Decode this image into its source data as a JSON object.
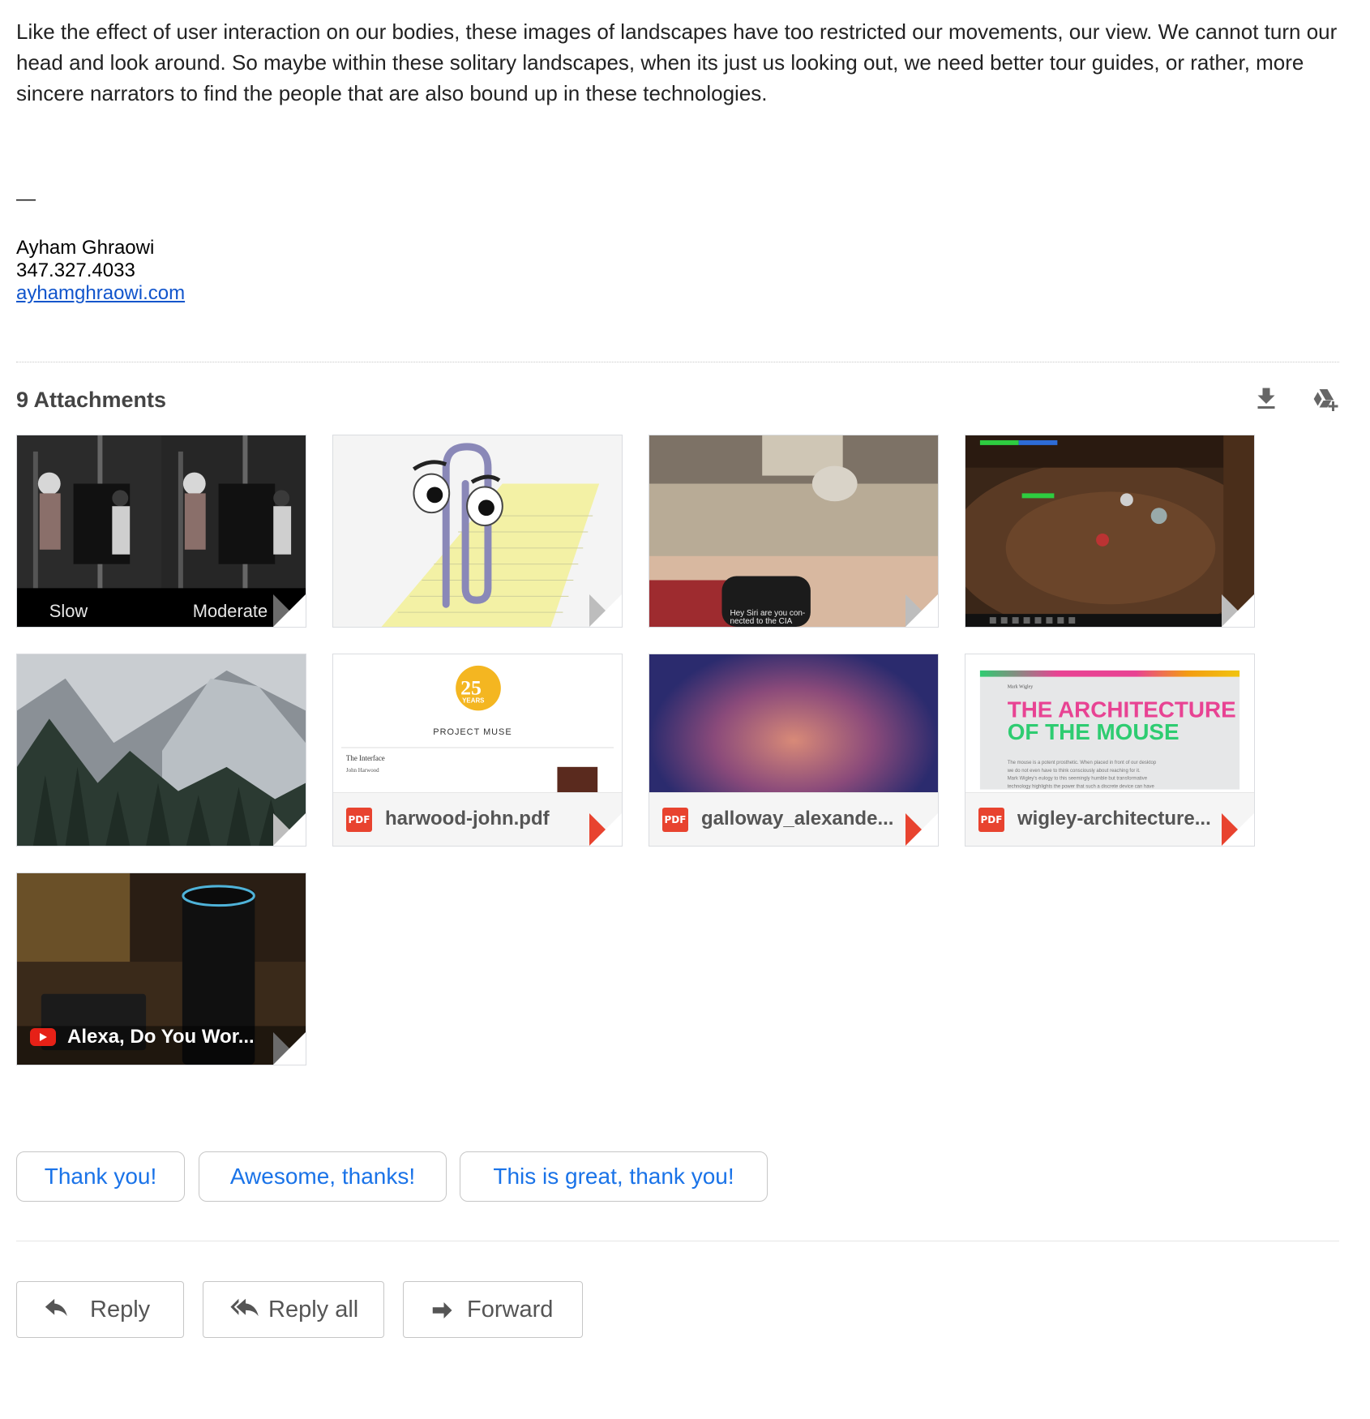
{
  "message": {
    "body": "Like the effect of user interaction on our bodies, these images of landscapes have too restricted our movements, our view. We cannot turn our head and look around. So maybe within these solitary landscapes, when its just us looking out, we need better tour guides, or rather, more sincere narrators to find the people that are also bound up in these technologies.",
    "dash": "—",
    "signature": {
      "name": "Ayham Ghraowi",
      "phone": "347.327.4033",
      "link": "ayhamghraowi.com"
    }
  },
  "attachments": {
    "title": "9 Attachments",
    "download_icon": "download-icon",
    "drive_icon": "add-to-drive-icon",
    "items": [
      {
        "kind": "image",
        "caption_left": "Slow",
        "caption_right": "Moderate"
      },
      {
        "kind": "image"
      },
      {
        "kind": "image",
        "caption": "Hey Siri are you con-nected to the CIA"
      },
      {
        "kind": "image"
      },
      {
        "kind": "image"
      },
      {
        "kind": "pdf",
        "name": "harwood-john.pdf",
        "badge": "PDF",
        "preview_top": "25",
        "preview_years": "YEARS",
        "preview_brand": "PROJECT MUSE",
        "preview_doc_title": "The Interface",
        "preview_doc_author": "John Harwood"
      },
      {
        "kind": "pdf",
        "name": "galloway_alexande...",
        "badge": "PDF"
      },
      {
        "kind": "pdf",
        "name": "wigley-architecture...",
        "badge": "PDF",
        "preview_author": "Mark Wigley",
        "preview_title_1": "THE ARCHITECTURE",
        "preview_title_2": "OF THE MOUSE",
        "preview_body_1": "The mouse is a potent prosthetic. When placed in front of our desktop",
        "preview_body_2": "we do not even have to think consciously about reaching for it.",
        "preview_body_3": "Mark Wigley's eulogy to this seemingly humble but transformative",
        "preview_body_4": "technology highlights the power that such a discrete device can have"
      },
      {
        "kind": "video",
        "name": "Alexa, Do You Wor..."
      }
    ]
  },
  "smart_replies": [
    "Thank you!",
    "Awesome, thanks!",
    "This is great, thank you!"
  ],
  "actions": {
    "reply": "Reply",
    "reply_all": "Reply all",
    "forward": "Forward"
  },
  "colors": {
    "link": "#1155cc",
    "chip_text": "#1a73e8",
    "pdf_red": "#e8432f",
    "youtube_red": "#e62117"
  }
}
